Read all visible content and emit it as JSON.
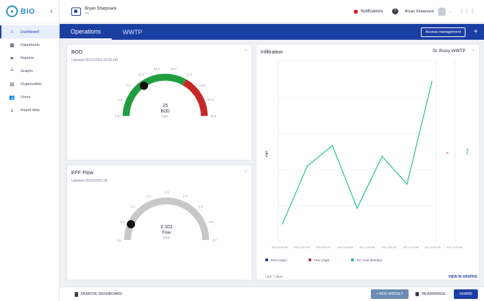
{
  "app": {
    "logo_text": "BIO",
    "collapse_glyph": "‹"
  },
  "sidebar": {
    "items": [
      {
        "label": "Dashboard",
        "icon": "home-icon",
        "glyph": "⌂",
        "active": true
      },
      {
        "label": "Datasheets",
        "icon": "table-icon",
        "glyph": "▦",
        "active": false
      },
      {
        "label": "Reports",
        "icon": "send-icon",
        "glyph": "➤",
        "active": false
      },
      {
        "label": "Graphs",
        "icon": "graph-icon",
        "glyph": "┴",
        "active": false
      },
      {
        "label": "Organization",
        "icon": "building-icon",
        "glyph": "▤",
        "active": false
      },
      {
        "label": "Users",
        "icon": "users-icon",
        "glyph": "👥",
        "active": false
      },
      {
        "label": "Import data",
        "icon": "import-icon",
        "glyph": "⇣",
        "active": false
      }
    ]
  },
  "topbar": {
    "user_name": "Bryan Sharpnack",
    "user_sub": "Plc",
    "notifications_label": "Notifications",
    "help_glyph": "?",
    "account_name": "Bryan Sharpnack",
    "caret_glyph": "⌄",
    "grid_glyph": "⋮⋮⋮"
  },
  "tabs": [
    {
      "label": "Operations",
      "active": true
    },
    {
      "label": "WWTP",
      "active": false
    }
  ],
  "access_management_label": "Access management",
  "add_tab_glyph": "+",
  "widgets": {
    "bod": {
      "title": "BOD",
      "updated": "Updated 06/10/2022 00:00 AM",
      "menu_glyph": "···",
      "value": "15",
      "unit": "BOD",
      "sub": "mg/L",
      "ticks": [
        "2.8",
        "4.8",
        "7.5",
        "10.0",
        "12.0",
        "15.0",
        "17.5",
        "19.0",
        "20.0",
        "22.5"
      ],
      "colors": {
        "red": "#c62828",
        "green": "#1f9d3f"
      }
    },
    "eff_flow": {
      "title": "EFF Flow",
      "updated": "Updated 06/10/2022 00",
      "menu_glyph": "···",
      "value": "2.101",
      "unit": "Flow",
      "sub": "MGD",
      "ticks": [
        "1.9",
        "2.0",
        "2.1",
        "2.2",
        "2.3",
        "2.4",
        "2.5",
        "2.6",
        "2.7"
      ],
      "colors": {
        "gray": "#c8c8c8"
      }
    },
    "infiltration": {
      "title": "Infiltration",
      "site": "St. Ricky WWTP",
      "menu_glyph": "···",
      "y_label": "mg/L",
      "right_label_1": "ft",
      "right_label_2": "mgd",
      "legend": [
        {
          "label": "BOD (mg/L)",
          "color": "#1f3fa3"
        },
        {
          "label": "Flow (mgd)",
          "color": "#b23a48"
        },
        {
          "label": "Tot. Load (lbs/day)",
          "color": "#2bb3a0"
        }
      ],
      "footer_left": "Last 7 days",
      "footer_right": "VIEW IN GRAPHS"
    }
  },
  "chart_data": {
    "type": "line",
    "title": "Infiltration",
    "x": [
      "4/19 12:00 AM",
      "4/19 12:00 PM",
      "4/20 4:00 PM",
      "4/20 12:00 AM",
      "4/21 12:00 AM",
      "4/21 4:00 AM",
      "4/21 11:30 AM",
      "4/21 12:00 PM",
      "4/22 12:00 AM"
    ],
    "series": [
      {
        "values": [
          0.15,
          0.63,
          0.8,
          0.28,
          0.71,
          0.48,
          1.33
        ]
      }
    ],
    "ylabel": "mg/L",
    "ylim": [
      0,
      1.5
    ],
    "color": "#2bc59a",
    "grid": true
  },
  "bottom": {
    "remove_label": "REMOVE DASHBOARD",
    "add_label": "+ ADD WIDGET",
    "rearrange_label": "REARRANGE",
    "share_label": "SHARE"
  }
}
